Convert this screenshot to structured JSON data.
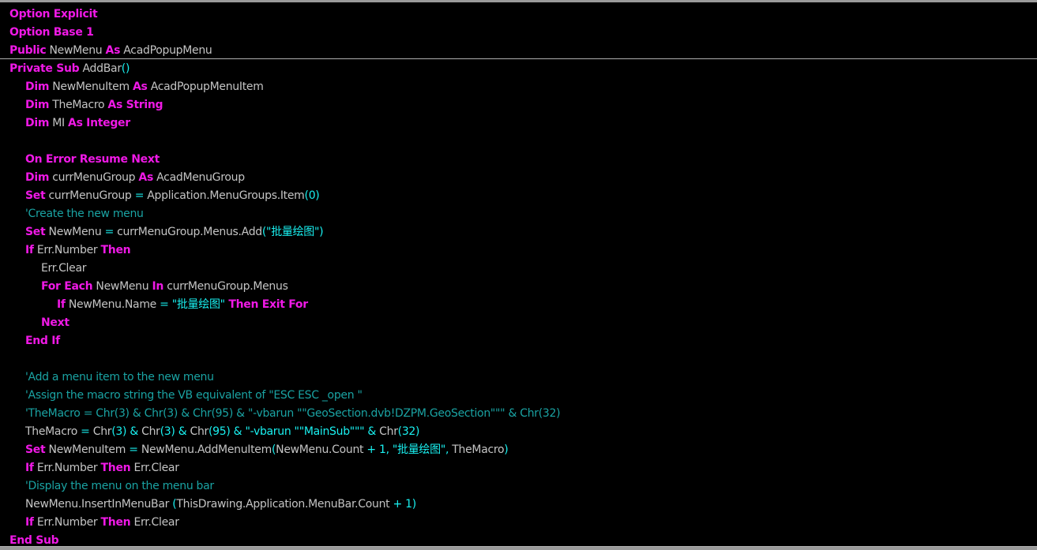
{
  "colors": {
    "keyword": "#f019e6",
    "identifier": "#c4c4c4",
    "punctuation": "#19f0f0",
    "comment": "#1aa3a3",
    "background": "#000000"
  },
  "code": [
    {
      "indent": 0,
      "tokens": [
        [
          "K",
          "Option Explicit"
        ]
      ]
    },
    {
      "indent": 0,
      "tokens": [
        [
          "K",
          "Option Base 1"
        ]
      ]
    },
    {
      "indent": 0,
      "tokens": [
        [
          "K",
          "Public"
        ],
        [
          "I",
          " NewMenu "
        ],
        [
          "K",
          "As"
        ],
        [
          "I",
          " AcadPopupMenu"
        ]
      ]
    },
    {
      "indent": 0,
      "tokens": [
        [
          "K",
          "Private Sub"
        ],
        [
          "I",
          " AddBar"
        ],
        [
          "P",
          "()"
        ]
      ]
    },
    {
      "indent": 1,
      "tokens": [
        [
          "K",
          "Dim"
        ],
        [
          "I",
          " NewMenuItem "
        ],
        [
          "K",
          "As"
        ],
        [
          "I",
          " AcadPopupMenuItem"
        ]
      ]
    },
    {
      "indent": 1,
      "tokens": [
        [
          "K",
          "Dim"
        ],
        [
          "I",
          " TheMacro "
        ],
        [
          "K",
          "As String"
        ]
      ]
    },
    {
      "indent": 1,
      "tokens": [
        [
          "K",
          "Dim"
        ],
        [
          "I",
          " MI "
        ],
        [
          "K",
          "As Integer"
        ]
      ]
    },
    {
      "indent": 1,
      "tokens": []
    },
    {
      "indent": 1,
      "tokens": [
        [
          "K",
          "On Error Resume Next"
        ]
      ]
    },
    {
      "indent": 1,
      "tokens": [
        [
          "K",
          "Dim"
        ],
        [
          "I",
          " currMenuGroup "
        ],
        [
          "K",
          "As"
        ],
        [
          "I",
          " AcadMenuGroup"
        ]
      ]
    },
    {
      "indent": 1,
      "tokens": [
        [
          "K",
          "Set"
        ],
        [
          "I",
          " currMenuGroup "
        ],
        [
          "P",
          "="
        ],
        [
          "I",
          " Application.MenuGroups.Item"
        ],
        [
          "P",
          "(0)"
        ]
      ]
    },
    {
      "indent": 1,
      "tokens": [
        [
          "C",
          "'Create the new menu"
        ]
      ]
    },
    {
      "indent": 1,
      "tokens": [
        [
          "K",
          "Set"
        ],
        [
          "I",
          " NewMenu "
        ],
        [
          "P",
          "="
        ],
        [
          "I",
          " currMenuGroup.Menus.Add"
        ],
        [
          "P",
          "(\"批量绘图\")"
        ]
      ]
    },
    {
      "indent": 1,
      "tokens": [
        [
          "K",
          "If"
        ],
        [
          "I",
          " Err.Number "
        ],
        [
          "K",
          "Then"
        ]
      ]
    },
    {
      "indent": 2,
      "tokens": [
        [
          "I",
          "Err.Clear"
        ]
      ]
    },
    {
      "indent": 2,
      "tokens": [
        [
          "K",
          "For Each"
        ],
        [
          "I",
          " NewMenu "
        ],
        [
          "K",
          "In"
        ],
        [
          "I",
          " currMenuGroup.Menus"
        ]
      ]
    },
    {
      "indent": 3,
      "tokens": [
        [
          "K",
          "If"
        ],
        [
          "I",
          " NewMenu.Name "
        ],
        [
          "P",
          "= \"批量绘图\""
        ],
        [
          "K",
          " Then Exit For"
        ]
      ]
    },
    {
      "indent": 2,
      "tokens": [
        [
          "K",
          "Next"
        ]
      ]
    },
    {
      "indent": 1,
      "tokens": [
        [
          "K",
          "End If"
        ]
      ]
    },
    {
      "indent": 1,
      "tokens": []
    },
    {
      "indent": 1,
      "tokens": [
        [
          "C",
          "'Add a menu item to the new menu"
        ]
      ]
    },
    {
      "indent": 1,
      "tokens": [
        [
          "C",
          "'Assign the macro string the VB equivalent of \"ESC ESC _open \""
        ]
      ]
    },
    {
      "indent": 1,
      "tokens": [
        [
          "C",
          "'TheMacro = Chr(3) & Chr(3) & Chr(95) & \"-vbarun \"\"GeoSection.dvb!DZPM.GeoSection\"\"\" & Chr(32)"
        ]
      ]
    },
    {
      "indent": 1,
      "tokens": [
        [
          "I",
          "TheMacro "
        ],
        [
          "P",
          "="
        ],
        [
          "I",
          " Chr"
        ],
        [
          "P",
          "(3) &"
        ],
        [
          "I",
          " Chr"
        ],
        [
          "P",
          "(3) &"
        ],
        [
          "I",
          " Chr"
        ],
        [
          "P",
          "(95) & \"-vbarun \"\"MainSub\"\"\" &"
        ],
        [
          "I",
          " Chr"
        ],
        [
          "P",
          "(32)"
        ]
      ]
    },
    {
      "indent": 1,
      "tokens": [
        [
          "K",
          "Set"
        ],
        [
          "I",
          " NewMenuItem "
        ],
        [
          "P",
          "="
        ],
        [
          "I",
          " NewMenu.AddMenuItem"
        ],
        [
          "P",
          "("
        ],
        [
          "I",
          "NewMenu.Count "
        ],
        [
          "P",
          "+ 1, \"批量绘图\","
        ],
        [
          "I",
          " TheMacro"
        ],
        [
          "P",
          ")"
        ]
      ]
    },
    {
      "indent": 1,
      "tokens": [
        [
          "K",
          "If"
        ],
        [
          "I",
          " Err.Number "
        ],
        [
          "K",
          "Then"
        ],
        [
          "I",
          " Err.Clear"
        ]
      ]
    },
    {
      "indent": 1,
      "tokens": [
        [
          "C",
          "'Display the menu on the menu bar"
        ]
      ]
    },
    {
      "indent": 1,
      "tokens": [
        [
          "I",
          "NewMenu.InsertInMenuBar "
        ],
        [
          "P",
          "("
        ],
        [
          "I",
          "ThisDrawing.Application.MenuBar.Count "
        ],
        [
          "P",
          "+ 1)"
        ]
      ]
    },
    {
      "indent": 1,
      "tokens": [
        [
          "K",
          "If"
        ],
        [
          "I",
          " Err.Number "
        ],
        [
          "K",
          "Then"
        ],
        [
          "I",
          " Err.Clear"
        ]
      ]
    },
    {
      "indent": 0,
      "tokens": [
        [
          "K",
          "End Sub"
        ]
      ]
    }
  ]
}
